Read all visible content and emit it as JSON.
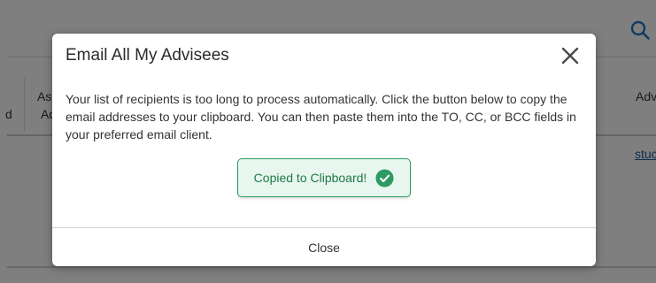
{
  "background": {
    "header_cells": [
      {
        "line1": "",
        "line2": "d"
      },
      {
        "line1": "As",
        "line2": "Ad"
      },
      {
        "line1": "Adv",
        "line2": ""
      }
    ],
    "row_link": "stuc"
  },
  "modal": {
    "title": "Email All My Advisees",
    "body": "Your list of recipients is too long to process automatically. Click the button below to copy the email addresses to your clipboard. You can then paste them into the TO, CC, or BCC fields in your preferred email client.",
    "copy_button_label": "Copied to Clipboard!",
    "footer_close_label": "Close"
  },
  "colors": {
    "success_green": "#2e9a63",
    "success_bg": "#e7f6ee",
    "link_blue": "#1a5a96",
    "search_icon": "#2874c4"
  },
  "icons": {
    "search": "search-icon",
    "close": "close-icon",
    "check": "check-circle-icon"
  }
}
